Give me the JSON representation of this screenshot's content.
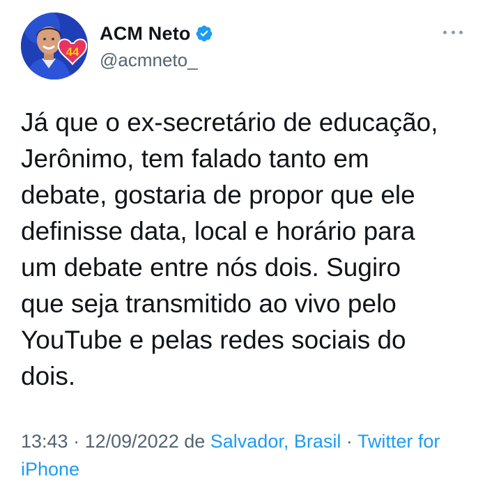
{
  "author": {
    "display_name": "ACM Neto",
    "handle": "@acmneto_",
    "avatar_badge": "44",
    "verified": true
  },
  "tweet": {
    "lines": [
      "Já que o ex-secretário de educação,",
      "Jerônimo, tem falado tanto em",
      "debate, gostaria de propor que ele",
      "definisse data, local e horário para",
      "um debate entre nós dois. Sugiro",
      "que seja transmitido ao vivo pelo",
      "YouTube e pelas redes sociais do",
      "dois."
    ]
  },
  "meta": {
    "time": "13:43",
    "separator1": " · ",
    "date": "12/09/2022",
    "from_word": " de ",
    "location": "Salvador, Brasil",
    "separator2": " · ",
    "source_part1": "Twitter for",
    "source_part2": "iPhone"
  },
  "colors": {
    "text": "#0f1419",
    "secondary": "#536471",
    "link": "#1d9bf0",
    "verified": "#1d9bf0",
    "avatar_bg": "#1f3fb6",
    "badge_heart": "#e8345e",
    "badge_text": "#ffd400"
  },
  "icons": {
    "verified": "verified-badge-icon",
    "more": "more-options-icon"
  }
}
